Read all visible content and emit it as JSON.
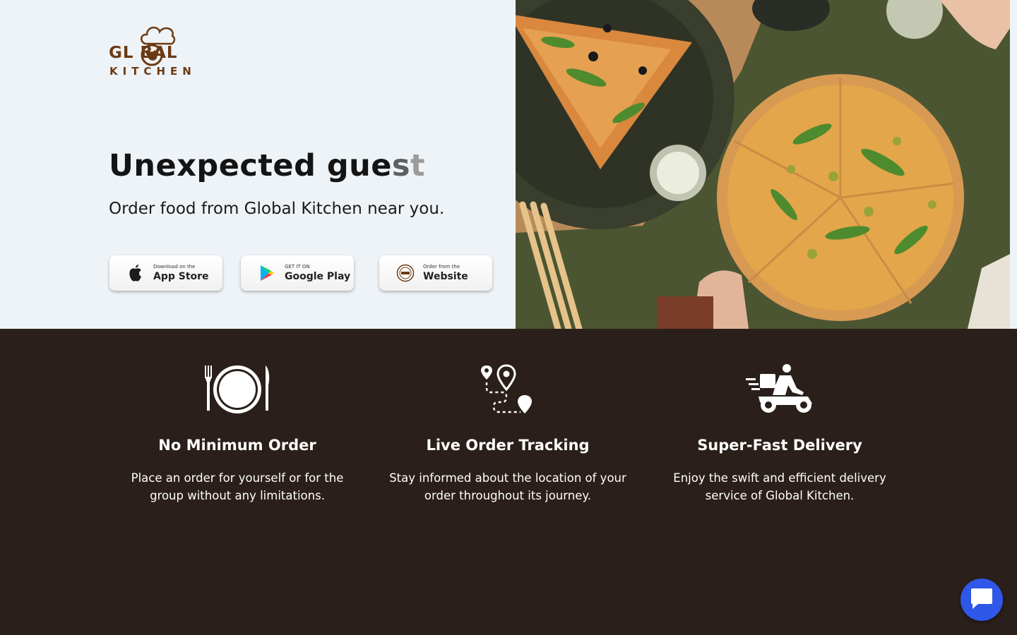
{
  "brand": {
    "logo_top": "GL BAL",
    "logo_bottom": "KITCHEN",
    "color": "#6b3a14"
  },
  "hero": {
    "headline_main": "Unexpected gue",
    "headline_fade1": "s",
    "headline_fade2": "t",
    "subline": "Order food from Global Kitchen near you.",
    "background": "#eef3f7"
  },
  "store_buttons": {
    "appstore": {
      "small": "Download on the",
      "big": "App Store",
      "icon": "apple-icon"
    },
    "gplay": {
      "small": "GET IT ON",
      "big": "Google Play",
      "icon": "google-play-icon"
    },
    "web": {
      "small": "Order from the",
      "big": "Website",
      "icon": "website-logo-icon"
    }
  },
  "features": [
    {
      "icon": "plate-cutlery-icon",
      "title": "No Minimum Order",
      "desc": "Place an order for yourself or for the group without any limitations."
    },
    {
      "icon": "route-pin-icon",
      "title": "Live Order Tracking",
      "desc": "Stay informed about the location of your order throughout its journey."
    },
    {
      "icon": "delivery-scooter-icon",
      "title": "Super-Fast Delivery",
      "desc": "Enjoy the swift and efficient delivery service of Global Kitchen."
    }
  ],
  "colors": {
    "features_bg": "#2a1f1a",
    "chat_button": "#2f57e8"
  },
  "chat": {
    "icon": "chat-bubble-icon"
  }
}
